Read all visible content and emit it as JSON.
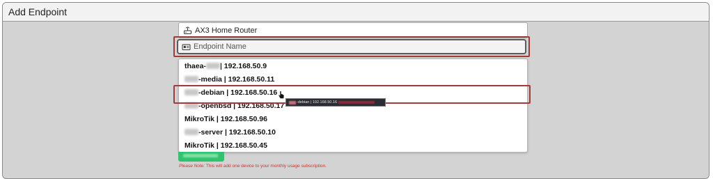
{
  "dialog": {
    "title": "Add Endpoint"
  },
  "form": {
    "device_label": "AX3 Home Router",
    "device_icon": "router-icon",
    "name_placeholder": "Endpoint Name",
    "name_icon": "id-card-icon",
    "submit_label": "Add Endpoint",
    "note_prefix": "Please Note:",
    "note_text": " This will add one device to your monthly usage subscription."
  },
  "dropdown": {
    "options": [
      {
        "prefix": "thaea-",
        "suffix": " | 192.168.50.9"
      },
      {
        "prefix": "",
        "suffix": "-media | 192.168.50.11"
      },
      {
        "prefix": "",
        "suffix": "-debian | 192.168.50.16"
      },
      {
        "prefix": "",
        "suffix": "-openbsd | 192.168.50.17"
      },
      {
        "prefix": "",
        "suffix": "MikroTik | 192.168.50.96"
      },
      {
        "prefix": "",
        "suffix": "-server | 192.168.50.10"
      },
      {
        "prefix": "",
        "suffix": "MikroTik | 192.168.50.45"
      }
    ],
    "selected_index": 2
  },
  "tooltip": {
    "text": "-debian | 192.168.50.16"
  },
  "colors": {
    "highlight_border": "#a33a3a",
    "submit_green": "#2ec46d",
    "note_red": "#d0342c"
  }
}
